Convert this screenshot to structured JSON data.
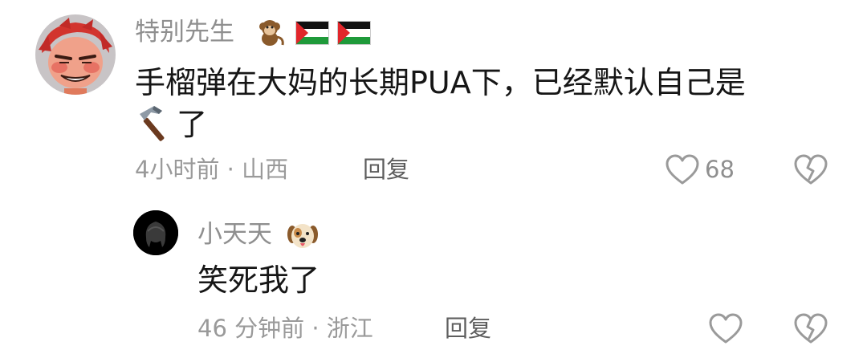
{
  "comments": [
    {
      "author": "特别先生",
      "badge_icons": [
        "monkey-emoji-icon",
        "palestine-flag-icon",
        "palestine-flag-icon"
      ],
      "text_line1": "手榴弹在大妈的长期PUA下，已经默认自己是",
      "text_line2": "了",
      "inline_icon": "hammer-emoji-icon",
      "time": "4小时前 · 山西",
      "reply_label": "回复",
      "like_count": "68"
    },
    {
      "author": "小天天",
      "badge_icons": [
        "dog-face-emoji-icon"
      ],
      "text": "笑死我了",
      "time": "46 分钟前 · 浙江",
      "reply_label": "回复"
    }
  ],
  "colors": {
    "meta_gray": "#9a9a9a",
    "text": "#161616",
    "palestine_red": "#e2262b",
    "palestine_green": "#1f9a3a"
  }
}
